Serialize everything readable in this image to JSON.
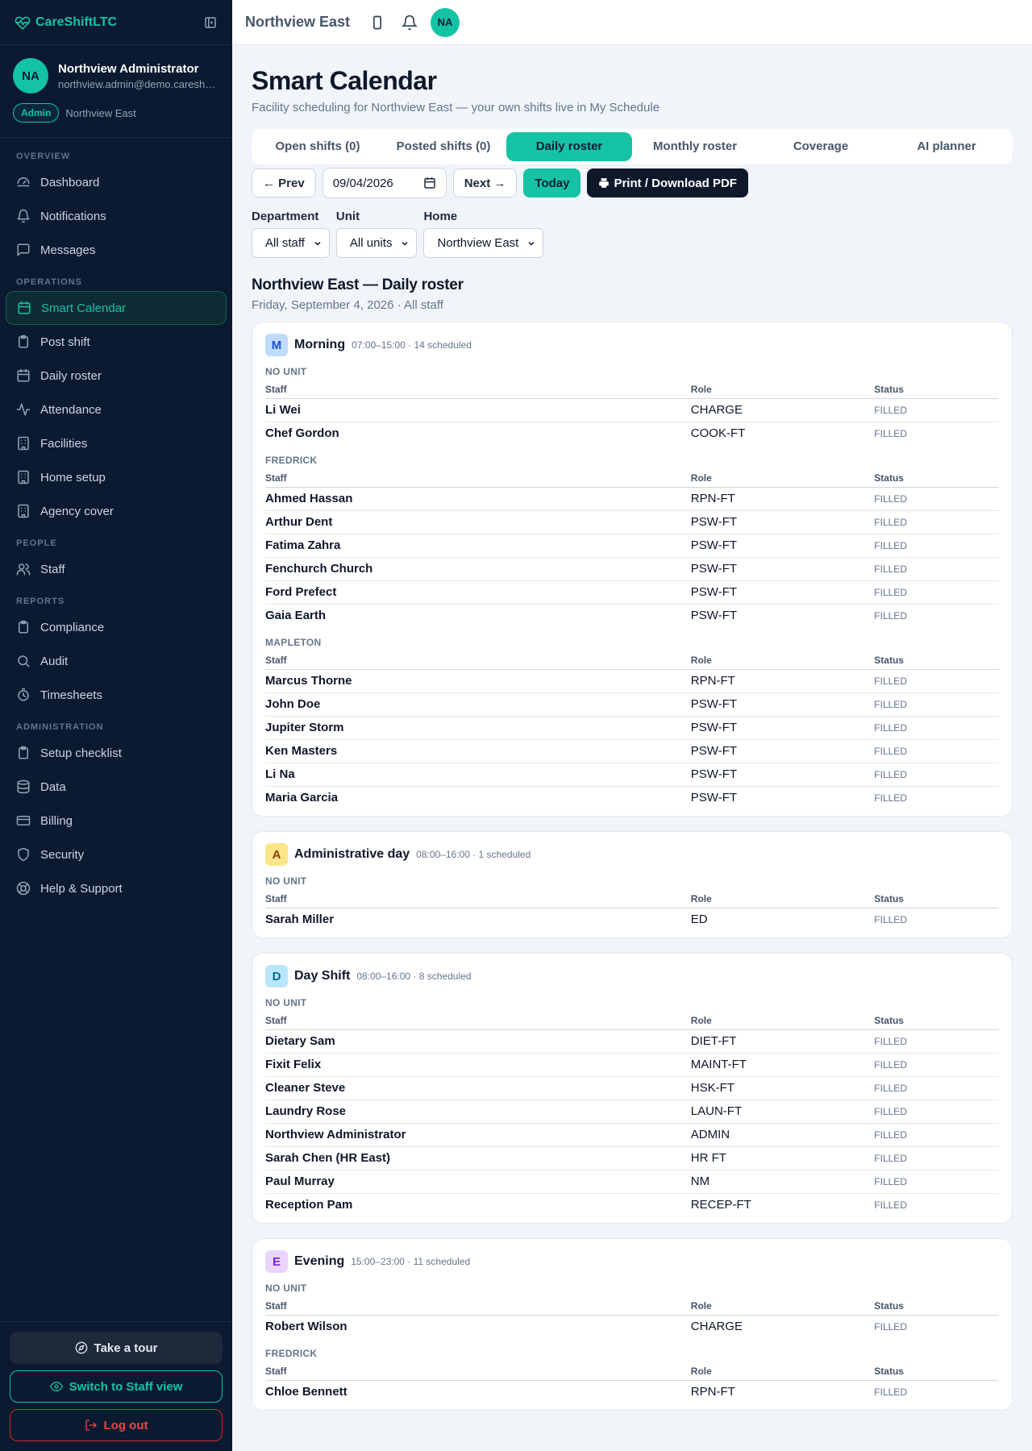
{
  "app": {
    "name": "CareShiftLTC"
  },
  "user": {
    "initials": "NA",
    "name": "Northview Administrator",
    "email": "northview.admin@demo.careshif...",
    "role": "Admin",
    "home": "Northview East"
  },
  "nav": {
    "sections": [
      {
        "title": "OVERVIEW",
        "items": [
          {
            "label": "Dashboard",
            "icon": "dashboard-icon"
          },
          {
            "label": "Notifications",
            "icon": "bell-icon"
          },
          {
            "label": "Messages",
            "icon": "message-icon"
          }
        ]
      },
      {
        "title": "OPERATIONS",
        "items": [
          {
            "label": "Smart Calendar",
            "icon": "calendar-icon",
            "active": true
          },
          {
            "label": "Post shift",
            "icon": "clipboard-icon"
          },
          {
            "label": "Daily roster",
            "icon": "calendar-icon"
          },
          {
            "label": "Attendance",
            "icon": "activity-icon"
          },
          {
            "label": "Facilities",
            "icon": "building-icon"
          },
          {
            "label": "Home setup",
            "icon": "building-icon"
          },
          {
            "label": "Agency cover",
            "icon": "building-icon"
          }
        ]
      },
      {
        "title": "PEOPLE",
        "items": [
          {
            "label": "Staff",
            "icon": "users-icon"
          }
        ]
      },
      {
        "title": "REPORTS",
        "items": [
          {
            "label": "Compliance",
            "icon": "clipboard-icon"
          },
          {
            "label": "Audit",
            "icon": "search-icon"
          },
          {
            "label": "Timesheets",
            "icon": "timer-icon"
          }
        ]
      },
      {
        "title": "ADMINISTRATION",
        "items": [
          {
            "label": "Setup checklist",
            "icon": "clipboard-icon"
          },
          {
            "label": "Data",
            "icon": "database-icon"
          },
          {
            "label": "Billing",
            "icon": "card-icon"
          },
          {
            "label": "Security",
            "icon": "shield-icon"
          },
          {
            "label": "Help & Support",
            "icon": "lifebuoy-icon"
          }
        ]
      }
    ]
  },
  "sidebar_bottom": {
    "tour": "Take a tour",
    "switch": "Switch to Staff view",
    "logout": "Log out"
  },
  "topbar": {
    "title": "Northview East",
    "avatar": "NA"
  },
  "page": {
    "title": "Smart Calendar",
    "subtitle": "Facility scheduling for Northview East — your own shifts live in My Schedule"
  },
  "tabs": [
    {
      "label": "Open shifts (0)"
    },
    {
      "label": "Posted shifts (0)"
    },
    {
      "label": "Daily roster",
      "active": true
    },
    {
      "label": "Monthly roster"
    },
    {
      "label": "Coverage"
    },
    {
      "label": "AI planner"
    }
  ],
  "toolbar": {
    "prev": "← Prev",
    "date": "09/04/2026",
    "next": "Next →",
    "today": "Today",
    "print": "Print / Download PDF"
  },
  "filters": {
    "department_label": "Department",
    "department_value": "All staff",
    "unit_label": "Unit",
    "unit_value": "All units",
    "home_label": "Home",
    "home_value": "Northview East"
  },
  "roster": {
    "title": "Northview East — Daily roster",
    "subtitle": "Friday, September 4, 2026 · All staff",
    "shifts": [
      {
        "letter": "M",
        "name": "Morning",
        "meta": "07:00–15:00 · 14 scheduled",
        "letter_bg": "#bfdbfe",
        "letter_color": "#1d4ed8",
        "units": [
          {
            "name": "NO UNIT",
            "rows": [
              [
                "Li Wei",
                "CHARGE",
                "FILLED"
              ],
              [
                "Chef Gordon",
                "COOK-FT",
                "FILLED"
              ]
            ]
          },
          {
            "name": "FREDRICK",
            "rows": [
              [
                "Ahmed Hassan",
                "RPN-FT",
                "FILLED"
              ],
              [
                "Arthur Dent",
                "PSW-FT",
                "FILLED"
              ],
              [
                "Fatima Zahra",
                "PSW-FT",
                "FILLED"
              ],
              [
                "Fenchurch Church",
                "PSW-FT",
                "FILLED"
              ],
              [
                "Ford Prefect",
                "PSW-FT",
                "FILLED"
              ],
              [
                "Gaia Earth",
                "PSW-FT",
                "FILLED"
              ]
            ]
          },
          {
            "name": "MAPLETON",
            "rows": [
              [
                "Marcus Thorne",
                "RPN-FT",
                "FILLED"
              ],
              [
                "John Doe",
                "PSW-FT",
                "FILLED"
              ],
              [
                "Jupiter Storm",
                "PSW-FT",
                "FILLED"
              ],
              [
                "Ken Masters",
                "PSW-FT",
                "FILLED"
              ],
              [
                "Li Na",
                "PSW-FT",
                "FILLED"
              ],
              [
                "Maria Garcia",
                "PSW-FT",
                "FILLED"
              ]
            ]
          }
        ]
      },
      {
        "letter": "A",
        "name": "Administrative day",
        "meta": "08:00–16:00 · 1 scheduled",
        "letter_bg": "#fde68a",
        "letter_color": "#92400e",
        "units": [
          {
            "name": "NO UNIT",
            "rows": [
              [
                "Sarah Miller",
                "ED",
                "FILLED"
              ]
            ]
          }
        ]
      },
      {
        "letter": "D",
        "name": "Day Shift",
        "meta": "08:00–16:00 · 8 scheduled",
        "letter_bg": "#bae6fd",
        "letter_color": "#0369a1",
        "units": [
          {
            "name": "NO UNIT",
            "rows": [
              [
                "Dietary Sam",
                "DIET-FT",
                "FILLED"
              ],
              [
                "Fixit Felix",
                "MAINT-FT",
                "FILLED"
              ],
              [
                "Cleaner Steve",
                "HSK-FT",
                "FILLED"
              ],
              [
                "Laundry Rose",
                "LAUN-FT",
                "FILLED"
              ],
              [
                "Northview Administrator",
                "ADMIN",
                "FILLED"
              ],
              [
                "Sarah Chen (HR East)",
                "HR FT",
                "FILLED"
              ],
              [
                "Paul Murray",
                "NM",
                "FILLED"
              ],
              [
                "Reception Pam",
                "RECEP-FT",
                "FILLED"
              ]
            ]
          }
        ]
      },
      {
        "letter": "E",
        "name": "Evening",
        "meta": "15:00–23:00 · 11 scheduled",
        "letter_bg": "#e9d5ff",
        "letter_color": "#7e22ce",
        "units": [
          {
            "name": "NO UNIT",
            "rows": [
              [
                "Robert Wilson",
                "CHARGE",
                "FILLED"
              ]
            ]
          },
          {
            "name": "FREDRICK",
            "rows": [
              [
                "Chloe Bennett",
                "RPN-FT",
                "FILLED"
              ]
            ]
          }
        ]
      }
    ],
    "headers": {
      "staff": "Staff",
      "role": "Role",
      "status": "Status"
    }
  }
}
